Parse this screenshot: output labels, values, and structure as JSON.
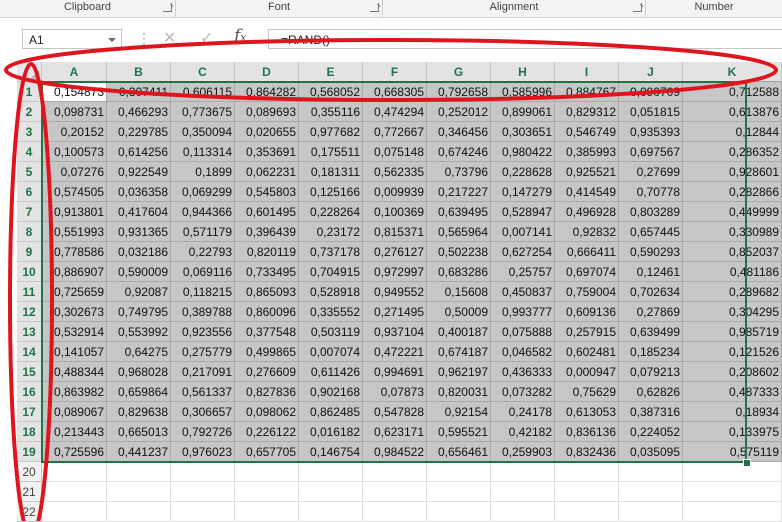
{
  "ribbon": {
    "groups": [
      "Clipboard",
      "Font",
      "Alignment",
      "Number"
    ]
  },
  "formula_bar": {
    "name_box": "A1",
    "formula": "=RAND()",
    "fx_symbol": "f",
    "cancel_symbol": "✕",
    "enter_symbol": "✓",
    "options_symbol": "⋮"
  },
  "sheet": {
    "columns": [
      "A",
      "B",
      "C",
      "D",
      "E",
      "F",
      "G",
      "H",
      "I",
      "J",
      "K"
    ],
    "row_numbers": [
      "1",
      "2",
      "3",
      "4",
      "5",
      "6",
      "7",
      "8",
      "9",
      "10",
      "11",
      "12",
      "13",
      "14",
      "15",
      "16",
      "17",
      "18",
      "19",
      "20",
      "21",
      "22"
    ],
    "rows": [
      [
        "0,154873",
        "0,307411",
        "0,606115",
        "0,864282",
        "0,568052",
        "0,668305",
        "0,792658",
        "0,585996",
        "0,884767",
        "0,090709",
        "0,712588"
      ],
      [
        "0,098731",
        "0,466293",
        "0,773675",
        "0,089693",
        "0,355116",
        "0,474294",
        "0,252012",
        "0,899061",
        "0,829312",
        "0,051815",
        "0,613876"
      ],
      [
        "0,20152",
        "0,229785",
        "0,350094",
        "0,020655",
        "0,977682",
        "0,772667",
        "0,346456",
        "0,303651",
        "0,546749",
        "0,935393",
        "0,12844"
      ],
      [
        "0,100573",
        "0,614256",
        "0,113314",
        "0,353691",
        "0,175511",
        "0,075148",
        "0,674246",
        "0,980422",
        "0,385993",
        "0,697567",
        "0,286352"
      ],
      [
        "0,07276",
        "0,922549",
        "0,1899",
        "0,062231",
        "0,181311",
        "0,562335",
        "0,73796",
        "0,228628",
        "0,925521",
        "0,27699",
        "0,928601"
      ],
      [
        "0,574505",
        "0,036358",
        "0,069299",
        "0,545803",
        "0,125166",
        "0,009939",
        "0,217227",
        "0,147279",
        "0,414549",
        "0,70778",
        "0,282866"
      ],
      [
        "0,913801",
        "0,417604",
        "0,944366",
        "0,601495",
        "0,228264",
        "0,100369",
        "0,639495",
        "0,528947",
        "0,496928",
        "0,803289",
        "0,449999"
      ],
      [
        "0,551993",
        "0,931365",
        "0,571179",
        "0,396439",
        "0,23172",
        "0,815371",
        "0,565964",
        "0,007141",
        "0,92832",
        "0,657445",
        "0,330989"
      ],
      [
        "0,778586",
        "0,032186",
        "0,22793",
        "0,820119",
        "0,737178",
        "0,276127",
        "0,502238",
        "0,627254",
        "0,666411",
        "0,590293",
        "0,852037"
      ],
      [
        "0,886907",
        "0,590009",
        "0,069116",
        "0,733495",
        "0,704915",
        "0,972997",
        "0,683286",
        "0,25757",
        "0,697074",
        "0,12461",
        "0,481186"
      ],
      [
        "0,725659",
        "0,92087",
        "0,118215",
        "0,865093",
        "0,528918",
        "0,949552",
        "0,15608",
        "0,450837",
        "0,759004",
        "0,702634",
        "0,289682"
      ],
      [
        "0,302673",
        "0,749795",
        "0,389788",
        "0,860096",
        "0,335552",
        "0,271495",
        "0,50009",
        "0,993777",
        "0,609136",
        "0,27869",
        "0,304295"
      ],
      [
        "0,532914",
        "0,553992",
        "0,923556",
        "0,377548",
        "0,503119",
        "0,937104",
        "0,400187",
        "0,075888",
        "0,257915",
        "0,639499",
        "0,985719"
      ],
      [
        "0,141057",
        "0,64275",
        "0,275779",
        "0,499865",
        "0,007074",
        "0,472221",
        "0,674187",
        "0,046582",
        "0,602481",
        "0,185234",
        "0,121526"
      ],
      [
        "0,488344",
        "0,968028",
        "0,217091",
        "0,276609",
        "0,611426",
        "0,994691",
        "0,962197",
        "0,436333",
        "0,000947",
        "0,079213",
        "0,208602"
      ],
      [
        "0,863982",
        "0,659864",
        "0,561337",
        "0,827836",
        "0,902168",
        "0,07873",
        "0,820031",
        "0,073282",
        "0,75629",
        "0,62826",
        "0,487333"
      ],
      [
        "0,089067",
        "0,829638",
        "0,306657",
        "0,098062",
        "0,862485",
        "0,547828",
        "0,92154",
        "0,24178",
        "0,613053",
        "0,387316",
        "0,18934"
      ],
      [
        "0,213443",
        "0,665013",
        "0,792726",
        "0,226122",
        "0,016182",
        "0,623171",
        "0,595521",
        "0,42182",
        "0,836136",
        "0,224052",
        "0,133975"
      ],
      [
        "0,725596",
        "0,441237",
        "0,976023",
        "0,657705",
        "0,146754",
        "0,984522",
        "0,656461",
        "0,259903",
        "0,832436",
        "0,035095",
        "0,575119"
      ]
    ]
  },
  "colors": {
    "accent": "#217346",
    "annotation": "#e0141e",
    "selection_fill": "#c6c6c6"
  }
}
